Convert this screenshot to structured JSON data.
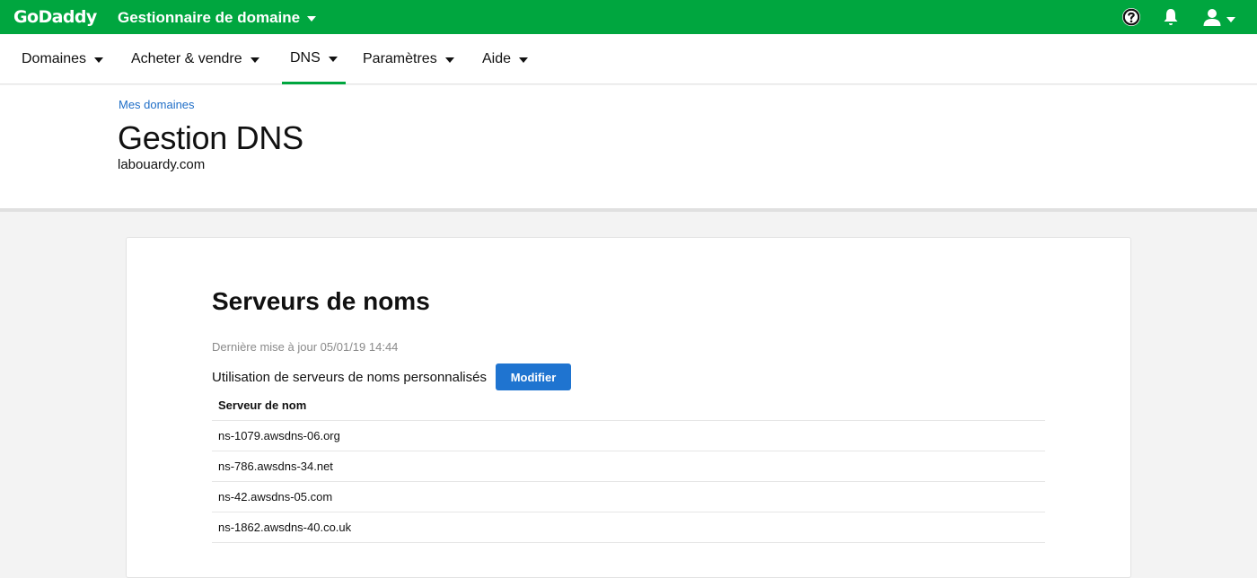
{
  "topbar": {
    "logo": "GoDaddy",
    "app_title": "Gestionnaire de domaine",
    "icons": [
      "help-icon",
      "bell-icon",
      "user-icon",
      "chevron-down-icon"
    ]
  },
  "nav": {
    "items": [
      {
        "label": "Domaines"
      },
      {
        "label": "Acheter & vendre"
      },
      {
        "label": "DNS"
      },
      {
        "label": "Paramètres"
      },
      {
        "label": "Aide"
      }
    ],
    "active": "DNS"
  },
  "header": {
    "breadcrumb": "Mes domaines",
    "title": "Gestion DNS",
    "domain": "labouardy.com"
  },
  "nameservers": {
    "title": "Serveurs de noms",
    "updated": "Dernière mise à jour 05/01/19 14:44",
    "custom_text": "Utilisation de serveurs de noms personnalisés",
    "modify_label": "Modifier",
    "column_header": "Serveur de nom",
    "rows": [
      "ns-1079.awsdns-06.org",
      "ns-786.awsdns-34.net",
      "ns-42.awsdns-05.com",
      "ns-1862.awsdns-40.co.uk"
    ]
  },
  "colors": {
    "brand_green": "#00a63f",
    "link_blue": "#1f6ec7",
    "button_blue": "#1f74d0"
  }
}
